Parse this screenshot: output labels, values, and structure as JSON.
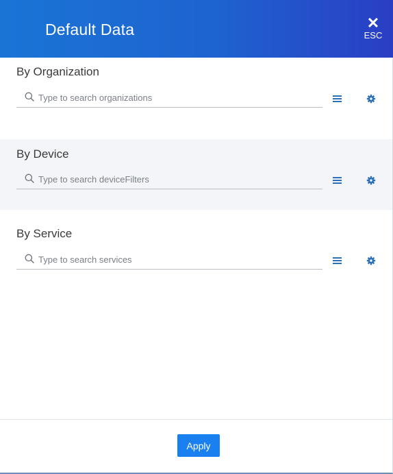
{
  "dialog": {
    "title": "Default Data",
    "close_label": "ESC",
    "close_glyph": "✕"
  },
  "sections": [
    {
      "label": "By Organization",
      "search_placeholder": "Type to search organizations",
      "search_value": ""
    },
    {
      "label": "By Device",
      "search_placeholder": "Type to search deviceFilters",
      "search_value": ""
    },
    {
      "label": "By Service",
      "search_placeholder": "Type to search services",
      "search_value": ""
    }
  ],
  "icons": {
    "search": "search-icon",
    "list": "list-icon",
    "settings": "gear-icon",
    "close": "close-icon"
  },
  "footer": {
    "apply_label": "Apply"
  },
  "colors": {
    "header_gradient_start": "#1a74d6",
    "header_gradient_end": "#2a3ec4",
    "accent": "#1a80f0",
    "icon": "#2b6fb8",
    "alt_row": "#f3f5f8"
  }
}
